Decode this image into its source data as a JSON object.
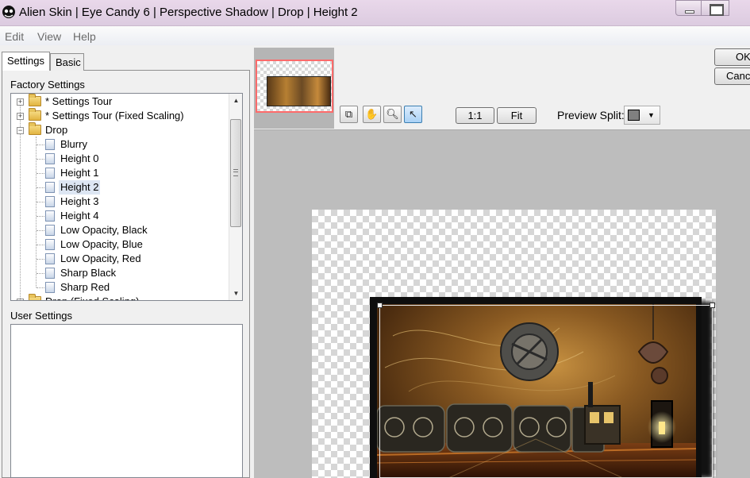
{
  "window": {
    "title": "Alien Skin | Eye Candy 6 | Perspective Shadow | Drop | Height 2"
  },
  "menu": [
    "Edit",
    "View",
    "Help"
  ],
  "tabs": {
    "settings": "Settings",
    "basic": "Basic"
  },
  "factory_settings": {
    "label": "Factory Settings",
    "items": [
      {
        "label": "* Settings Tour",
        "type": "folder",
        "expander": "+"
      },
      {
        "label": "* Settings Tour (Fixed Scaling)",
        "type": "folder",
        "expander": "+"
      },
      {
        "label": "Drop",
        "type": "folder",
        "expander": "−"
      },
      {
        "label": "Blurry",
        "type": "preset"
      },
      {
        "label": "Height 0",
        "type": "preset"
      },
      {
        "label": "Height 1",
        "type": "preset"
      },
      {
        "label": "Height 2",
        "type": "preset",
        "selected": true
      },
      {
        "label": "Height 3",
        "type": "preset"
      },
      {
        "label": "Height 4",
        "type": "preset"
      },
      {
        "label": "Low Opacity, Black",
        "type": "preset"
      },
      {
        "label": "Low Opacity, Blue",
        "type": "preset"
      },
      {
        "label": "Low Opacity, Red",
        "type": "preset"
      },
      {
        "label": "Sharp Black",
        "type": "preset"
      },
      {
        "label": "Sharp Red",
        "type": "preset"
      },
      {
        "label": "Drop (Fixed Scaling)",
        "type": "folder",
        "expander": "+"
      }
    ]
  },
  "user_settings": {
    "label": "User Settings"
  },
  "preview_toolbar": {
    "zoom_1to1": "1:1",
    "fit": "Fit",
    "preview_split_label": "Preview Split:",
    "tools": [
      "split-view-icon",
      "hand-icon",
      "zoom-icon",
      "pointer-icon"
    ]
  },
  "dialog_buttons": {
    "ok": "OK",
    "cancel": "Cancel"
  },
  "colors": {
    "titlebar": "#dccbe0",
    "selection_highlight": "#dde6f3",
    "navigator_border": "#ff6b6b",
    "active_tool": "#a9d1f5",
    "split_swatch": "#808080"
  }
}
